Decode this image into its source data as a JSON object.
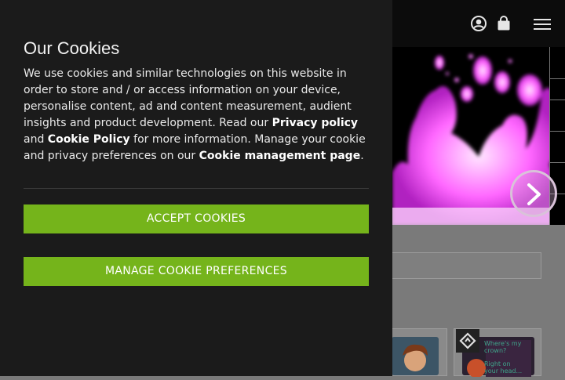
{
  "cookie_banner": {
    "title": "Our Cookies",
    "body_part1": "We use cookies and similar technologies on this website in order to store and / or access information on your device, personalise content, ad and content measurement, audient insights and product development. Read our ",
    "privacy_link": "Privacy policy",
    "and_text": " and ",
    "cookie_policy_link": "Cookie Policy",
    "body_part2": " for more information. Manage your cookie and privacy preferences on our ",
    "management_link": "Cookie management page",
    "body_end": ".",
    "accept_label": "ACCEPT COOKIES",
    "manage_label": "MANAGE COOKIE PREFERENCES"
  },
  "header": {
    "icons": [
      "user-icon",
      "shopping-bag-icon",
      "hamburger-menu-icon"
    ]
  },
  "cards": [
    {
      "caption_lines": []
    },
    {
      "caption_lines": [
        "Where's my",
        "crown?",
        "Right on",
        "your head..."
      ]
    }
  ],
  "colors": {
    "accent_green": "#75b41b",
    "panel_bg": "#1b1b1b",
    "banner_pink": "#ff6cff"
  }
}
